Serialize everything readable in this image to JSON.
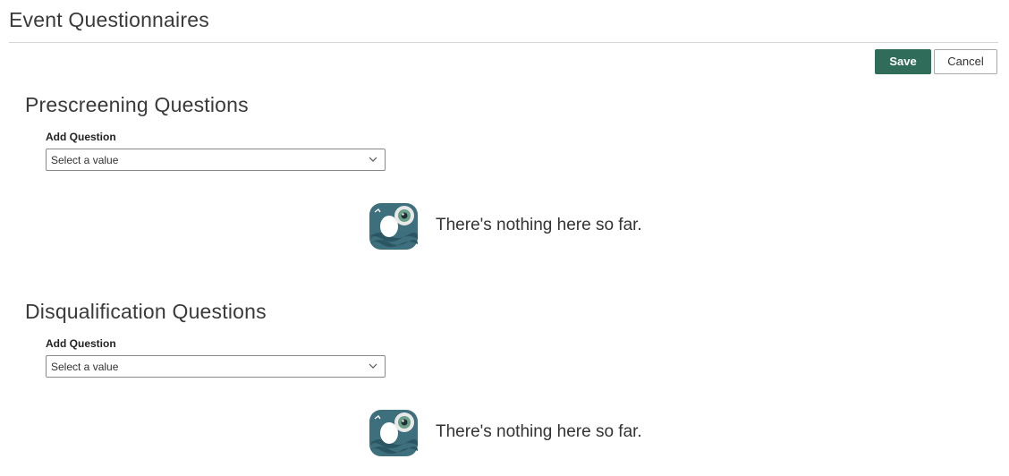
{
  "page": {
    "title": "Event Questionnaires"
  },
  "toolbar": {
    "save_label": "Save",
    "cancel_label": "Cancel"
  },
  "sections": [
    {
      "title": "Prescreening Questions",
      "field_label": "Add Question",
      "select_value": "Select a value",
      "empty_text": "There's nothing here so far.",
      "empty_icon": "binoculars-illustration-icon"
    },
    {
      "title": "Disqualification Questions",
      "field_label": "Add Question",
      "select_value": "Select a value",
      "empty_text": "There's nothing here so far.",
      "empty_icon": "binoculars-illustration-icon"
    }
  ],
  "colors": {
    "primary_button": "#2f6d5a",
    "illustration_teal": "#3e6f7c"
  }
}
